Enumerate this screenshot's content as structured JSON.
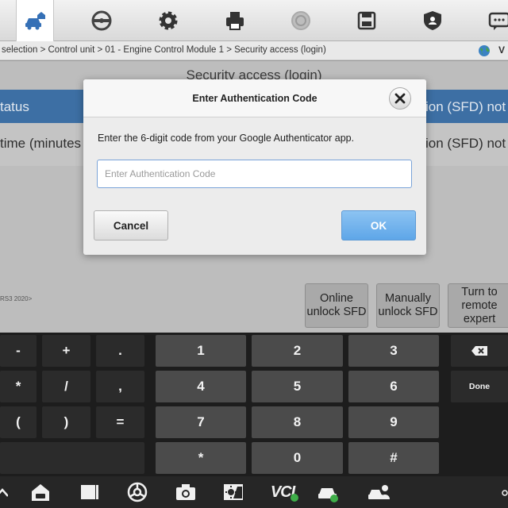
{
  "toolbar": {
    "icons": [
      "vehicle-home-icon",
      "steering-wheel-icon",
      "gear-icon",
      "printer-icon",
      "help-icon",
      "save-icon",
      "shield-user-icon",
      "message-icon"
    ]
  },
  "breadcrumb": {
    "path": "selection > Control unit > 01 - Engine Control Module 1 > Security access (login)",
    "language": "V"
  },
  "main": {
    "page_title": "Security access (login)",
    "row1_left": "tatus",
    "row1_right": "ion (SFD) not",
    "row2_left": "time (minutes",
    "row2_right": "ion (SFD) not",
    "version": "RS3 2020>",
    "buttons": {
      "online_unlock": "Online unlock SFD",
      "manual_unlock": "Manually unlock SFD",
      "remote_expert": "Turn to remote expert"
    }
  },
  "dialog": {
    "title": "Enter Authentication Code",
    "message": "Enter the 6-digit code from your Google Authenticator app.",
    "input_placeholder": "Enter Authentication Code",
    "input_value": "",
    "cancel_label": "Cancel",
    "ok_label": "OK"
  },
  "keyboard": {
    "symbols": [
      "-",
      "+",
      ".",
      "*",
      "/",
      ",",
      "(",
      ")",
      "="
    ],
    "digits": [
      "1",
      "2",
      "3",
      "4",
      "5",
      "6",
      "7",
      "8",
      "9",
      "*",
      "0",
      "#"
    ],
    "done_label": "Done"
  },
  "navbar": {
    "vci_label": "VCI"
  },
  "colors": {
    "accent_blue": "#5ea6e8",
    "row_highlight": "#3d6fa4",
    "keyboard_bg": "#1d1d1d"
  }
}
